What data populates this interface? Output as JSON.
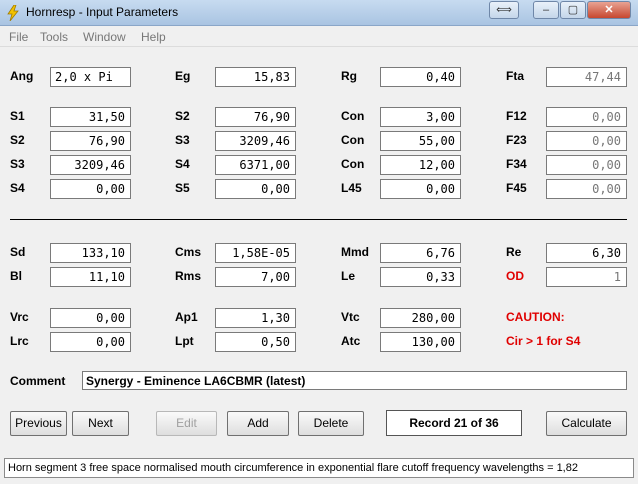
{
  "window": {
    "title": "Hornresp - Input Parameters",
    "buttons": {
      "swap": "⟺",
      "minimize": "–",
      "maximize": "▢",
      "close": "✕"
    }
  },
  "menu": [
    "File",
    "Tools",
    "Window",
    "Help"
  ],
  "params": {
    "Ang": {
      "label": "Ang",
      "value": "2,0 x Pi"
    },
    "Eg": {
      "label": "Eg",
      "value": "15,83"
    },
    "Rg": {
      "label": "Rg",
      "value": "0,40"
    },
    "Fta": {
      "label": "Fta",
      "value": "47,44"
    },
    "S1": {
      "label": "S1",
      "value": "31,50"
    },
    "S2a": {
      "label": "S2",
      "value": "76,90"
    },
    "Con1": {
      "label": "Con",
      "value": "3,00"
    },
    "F12": {
      "label": "F12",
      "value": "0,00"
    },
    "S2": {
      "label": "S2",
      "value": "76,90"
    },
    "S3a": {
      "label": "S3",
      "value": "3209,46"
    },
    "Con2": {
      "label": "Con",
      "value": "55,00"
    },
    "F23": {
      "label": "F23",
      "value": "0,00"
    },
    "S3": {
      "label": "S3",
      "value": "3209,46"
    },
    "S4a": {
      "label": "S4",
      "value": "6371,00"
    },
    "Con3": {
      "label": "Con",
      "value": "12,00"
    },
    "F34": {
      "label": "F34",
      "value": "0,00"
    },
    "S4": {
      "label": "S4",
      "value": "0,00"
    },
    "S5": {
      "label": "S5",
      "value": "0,00"
    },
    "L45": {
      "label": "L45",
      "value": "0,00"
    },
    "F45": {
      "label": "F45",
      "value": "0,00"
    },
    "Sd": {
      "label": "Sd",
      "value": "133,10"
    },
    "Cms": {
      "label": "Cms",
      "value": "1,58E-05"
    },
    "Mmd": {
      "label": "Mmd",
      "value": "6,76"
    },
    "Re": {
      "label": "Re",
      "value": "6,30"
    },
    "Bl": {
      "label": "Bl",
      "value": "11,10"
    },
    "Rms": {
      "label": "Rms",
      "value": "7,00"
    },
    "Le": {
      "label": "Le",
      "value": "0,33"
    },
    "OD": {
      "label": "OD",
      "value": "1"
    },
    "Vrc": {
      "label": "Vrc",
      "value": "0,00"
    },
    "Ap1": {
      "label": "Ap1",
      "value": "1,30"
    },
    "Vtc": {
      "label": "Vtc",
      "value": "280,00"
    },
    "Lrc": {
      "label": "Lrc",
      "value": "0,00"
    },
    "Lpt": {
      "label": "Lpt",
      "value": "0,50"
    },
    "Atc": {
      "label": "Atc",
      "value": "130,00"
    }
  },
  "caution": {
    "title": "CAUTION:",
    "message": "Cir > 1 for S4"
  },
  "comment": {
    "label": "Comment",
    "value": "Synergy - Eminence LA6CBMR  (latest)"
  },
  "buttons": {
    "previous": "Previous",
    "next": "Next",
    "edit": "Edit",
    "add": "Add",
    "delete": "Delete",
    "calculate": "Calculate"
  },
  "record": "Record 21 of 36",
  "status": "Horn segment 3 free space normalised mouth circumference in exponential flare cutoff frequency wavelengths = 1,82",
  "colors": {
    "caution": "#e00000",
    "titlebar": "#b9d1ea"
  }
}
